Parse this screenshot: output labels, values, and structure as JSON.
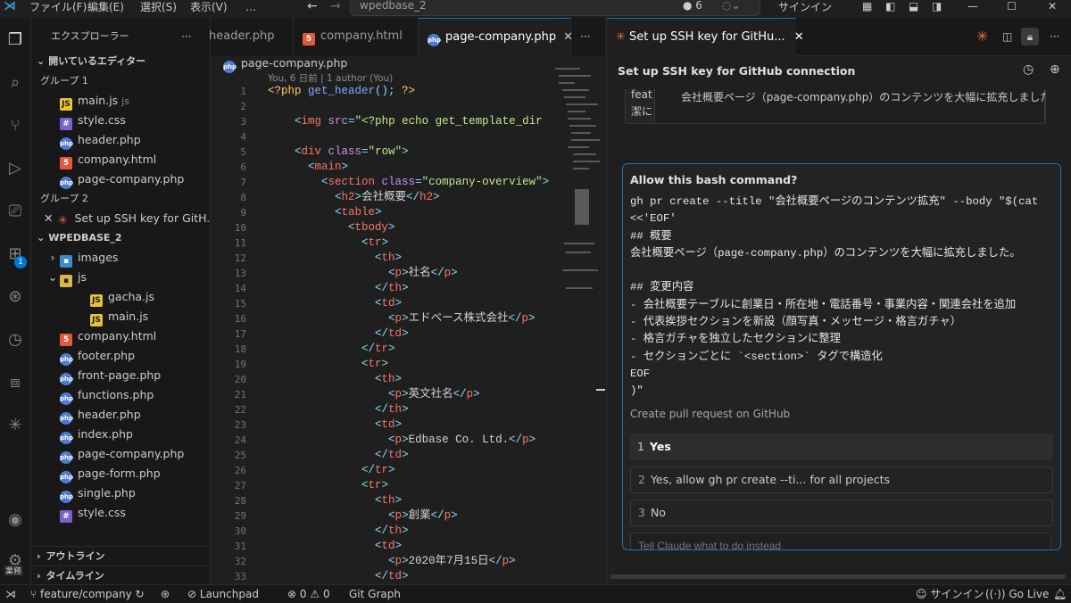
{
  "titlebar": {
    "menus": [
      "ファイル(F)",
      "編集(E)",
      "選択(S)",
      "表示(V)",
      "…"
    ],
    "search": "wpedbase_2",
    "badge_count": "6",
    "signin": "サインイン"
  },
  "sidebar": {
    "title": "エクスプローラー",
    "open_editors_label": "開いているエディター",
    "group1_label": "グループ 1",
    "group1": [
      {
        "name": "main.js",
        "extra": "js",
        "type": "js"
      },
      {
        "name": "style.css",
        "type": "css"
      },
      {
        "name": "header.php",
        "type": "php"
      },
      {
        "name": "company.html",
        "type": "html"
      },
      {
        "name": "page-company.php",
        "type": "php"
      }
    ],
    "group2_label": "グループ 2",
    "group2_item": "Set up SSH key for GitH...",
    "project_label": "WPEDBASE_2",
    "tree": [
      {
        "name": "images",
        "type": "folder",
        "indent": 1,
        "chev": "›"
      },
      {
        "name": "js",
        "type": "folder-open",
        "indent": 1,
        "chev": "⌄"
      },
      {
        "name": "gacha.js",
        "type": "js",
        "indent": 2
      },
      {
        "name": "main.js",
        "type": "js",
        "indent": 2
      },
      {
        "name": "company.html",
        "type": "html",
        "indent": 1
      },
      {
        "name": "footer.php",
        "type": "php",
        "indent": 1
      },
      {
        "name": "front-page.php",
        "type": "php",
        "indent": 1
      },
      {
        "name": "functions.php",
        "type": "php",
        "indent": 1
      },
      {
        "name": "header.php",
        "type": "php",
        "indent": 1
      },
      {
        "name": "index.php",
        "type": "php",
        "indent": 1
      },
      {
        "name": "page-company.php",
        "type": "php",
        "indent": 1
      },
      {
        "name": "page-form.php",
        "type": "php",
        "indent": 1
      },
      {
        "name": "single.php",
        "type": "php",
        "indent": 1
      },
      {
        "name": "style.css",
        "type": "css",
        "indent": 1
      }
    ],
    "outline_label": "アウトライン",
    "timeline_label": "タイムライン",
    "extensions_badge": "1",
    "account_label": "業務"
  },
  "editor": {
    "tabs": [
      {
        "label": "header.php",
        "icon": "php",
        "active": false
      },
      {
        "label": "company.html",
        "icon": "html",
        "active": false
      },
      {
        "label": "page-company.php",
        "icon": "php",
        "active": true
      }
    ],
    "breadcrumb": "page-company.php",
    "blame": "You, 6 日前 | 1 author (You)"
  },
  "panel": {
    "tab_label": "Set up SSH key for GitHu...",
    "header_title": "Set up SSH key for GitHub connection",
    "prev_message_left": "feat\n潔に",
    "prev_message_text": "会社概要ページ（page-company.php）のコンテンツを大幅に拡充しました。",
    "prompt_title": "Allow this bash command?",
    "command_lines": [
      "gh pr create --title \"会社概要ページのコンテンツ拡充\" --body \"$(cat",
      "<<'EOF'",
      "## 概要",
      "会社概要ページ（page-company.php）のコンテンツを大幅に拡充しました。",
      "",
      "## 変更内容",
      "- 会社概要テーブルに創業日・所在地・電話番号・事業内容・関連会社を追加",
      "- 代表挨拶セクションを新設（顔写真・メッセージ・格言ガチャ）",
      "- 格言ガチャを独立したセクションに整理",
      "- セクションごとに `<section>` タグで構造化",
      "EOF",
      ")\""
    ],
    "description": "Create pull request on GitHub",
    "options": [
      {
        "num": "1",
        "label": "Yes"
      },
      {
        "num": "2",
        "label": "Yes, allow gh pr create --ti... for all projects"
      },
      {
        "num": "3",
        "label": "No"
      }
    ],
    "input_placeholder": "Tell Claude what to do instead"
  },
  "statusbar": {
    "branch": "feature/company",
    "launchpad": "Launchpad",
    "errors": "0",
    "warnings": "0",
    "gitgraph": "Git Graph",
    "signin": "サインイン",
    "golive": "Go Live"
  },
  "colors": {
    "accent": "#0078d4",
    "claude": "#e86b4a"
  }
}
